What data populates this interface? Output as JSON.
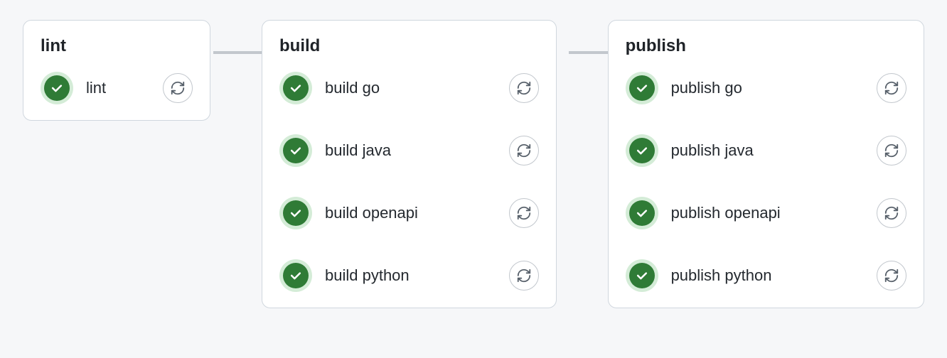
{
  "colors": {
    "success": "#2f7b36",
    "successRing": "#d4ecd7",
    "border": "#d0d7de",
    "pageBg": "#f6f7f9",
    "cardBg": "#ffffff",
    "text": "#1f2328"
  },
  "stages": {
    "lint": {
      "title": "lint",
      "jobs": [
        "lint"
      ]
    },
    "build": {
      "title": "build",
      "jobs": [
        "build go",
        "build java",
        "build openapi",
        "build python"
      ]
    },
    "publish": {
      "title": "publish",
      "jobs": [
        "publish go",
        "publish java",
        "publish openapi",
        "publish python"
      ]
    }
  }
}
